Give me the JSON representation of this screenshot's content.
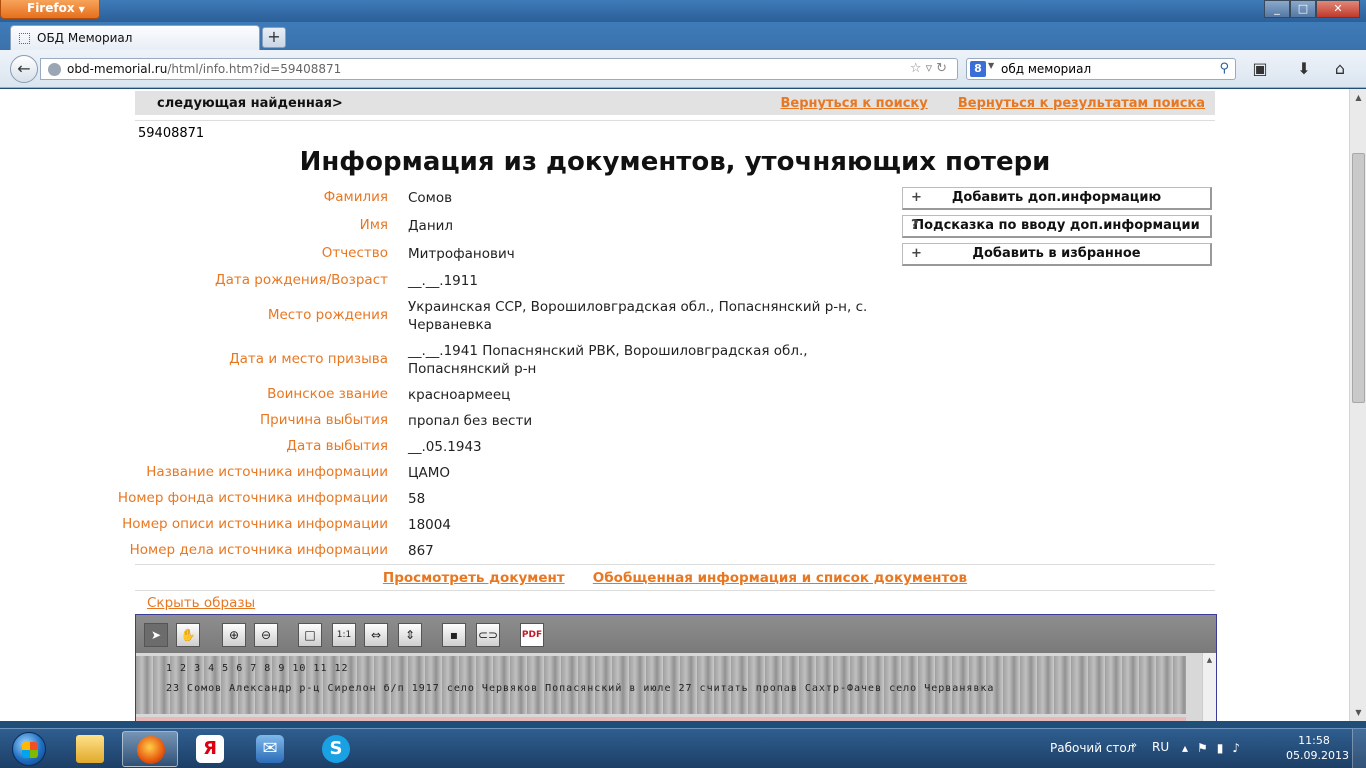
{
  "browser": {
    "app_button": "Firefox",
    "tab_title": "ОБД Мемориал",
    "new_tab_symbol": "+",
    "url_host": "obd-memorial.ru",
    "url_path": "/html/info.htm?id=59408871",
    "search_engine_letter": "8",
    "search_text": "обд мемориал"
  },
  "page": {
    "next_found": "следующая найденная>",
    "back_to_search": "Вернуться к поиску",
    "back_to_results": "Вернуться к результатам поиска",
    "record_id": "59408871",
    "title": "Информация из документов, уточняющих потери",
    "fields": [
      {
        "label": "Фамилия",
        "value": "Сомов"
      },
      {
        "label": "Имя",
        "value": "Данил"
      },
      {
        "label": "Отчество",
        "value": "Митрофанович"
      },
      {
        "label": "Дата рождения/Возраст",
        "value": "__.__.1911"
      },
      {
        "label": "Место рождения",
        "value": "Украинская ССР, Ворошиловградская обл., Попаснянский р-н, с. Черваневка"
      },
      {
        "label": "Дата и место призыва",
        "value": "__.__.1941 Попаснянский РВК, Ворошиловградская обл., Попаснянский р-н"
      },
      {
        "label": "Воинское звание",
        "value": "красноармеец"
      },
      {
        "label": "Причина выбытия",
        "value": "пропал без вести"
      },
      {
        "label": "Дата выбытия",
        "value": "__.05.1943"
      },
      {
        "label": "Название источника информации",
        "value": "ЦАМО"
      },
      {
        "label": "Номер фонда источника информации",
        "value": "58"
      },
      {
        "label": "Номер описи источника информации",
        "value": "18004"
      },
      {
        "label": "Номер дела источника информации",
        "value": "867"
      }
    ],
    "side_buttons": [
      {
        "prefix": "+",
        "label": "Добавить доп.информацию"
      },
      {
        "prefix": "?",
        "label": "Подсказка по вводу доп.информации"
      },
      {
        "prefix": "+",
        "label": "Добавить в избранное"
      }
    ],
    "view_document": "Просмотреть документ",
    "summary_info": "Обобщенная информация и список документов",
    "hide_images": "Скрыть образы"
  },
  "viewer": {
    "zoom_1to1": "1:1",
    "pdf_label": "PDF",
    "scan_row1": "1   2        3      4      5   6       7          8        9    10        11             12",
    "scan_row2": "23  Сомов  Александр  р-ц  Сирелон  б/п  1917  село Червяков Попасянский  в июле 27  считать пропав Сахтр-Фачев  село Черванявка"
  },
  "taskbar": {
    "desktop_label": "Рабочий стол",
    "lang": "RU",
    "time": "11:58",
    "date": "05.09.2013",
    "yandex_letter": "Я",
    "skype_letter": "S"
  }
}
